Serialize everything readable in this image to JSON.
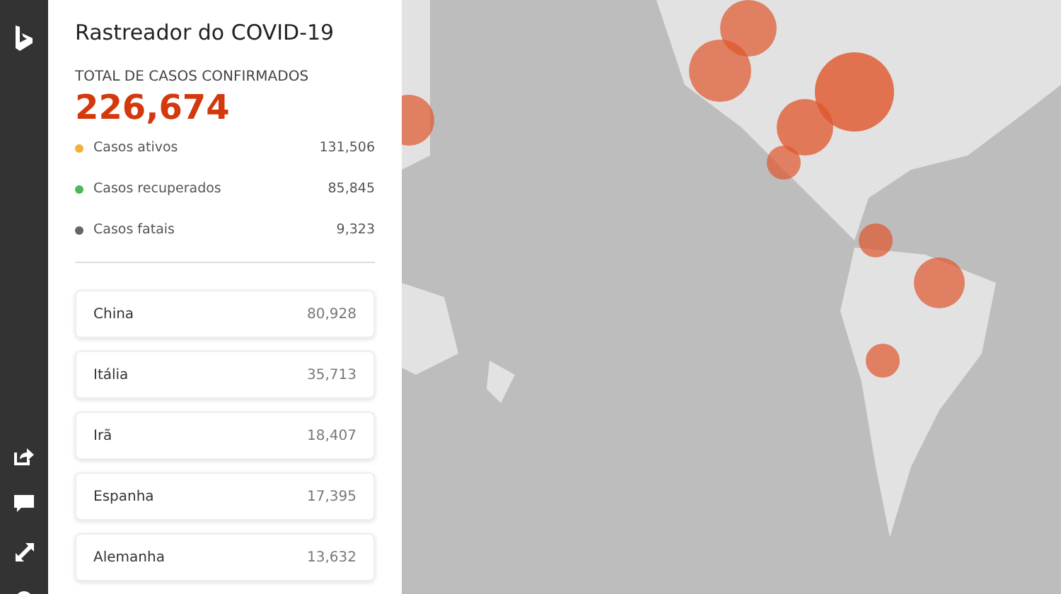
{
  "panel": {
    "title": "Rastreador do COVID-19",
    "total_label": "TOTAL DE CASOS CONFIRMADOS",
    "total": "226,674",
    "stats": [
      {
        "label": "Casos ativos",
        "value": "131,506",
        "color": "#f2b13a"
      },
      {
        "label": "Casos recuperados",
        "value": "85,845",
        "color": "#4cb856"
      },
      {
        "label": "Casos fatais",
        "value": "9,323",
        "color": "#666666"
      }
    ],
    "countries": [
      {
        "name": "China",
        "cases": "80,928"
      },
      {
        "name": "Itália",
        "cases": "35,713"
      },
      {
        "name": "Irã",
        "cases": "18,407"
      },
      {
        "name": "Espanha",
        "cases": "17,395"
      },
      {
        "name": "Alemanha",
        "cases": "13,632"
      }
    ]
  }
}
